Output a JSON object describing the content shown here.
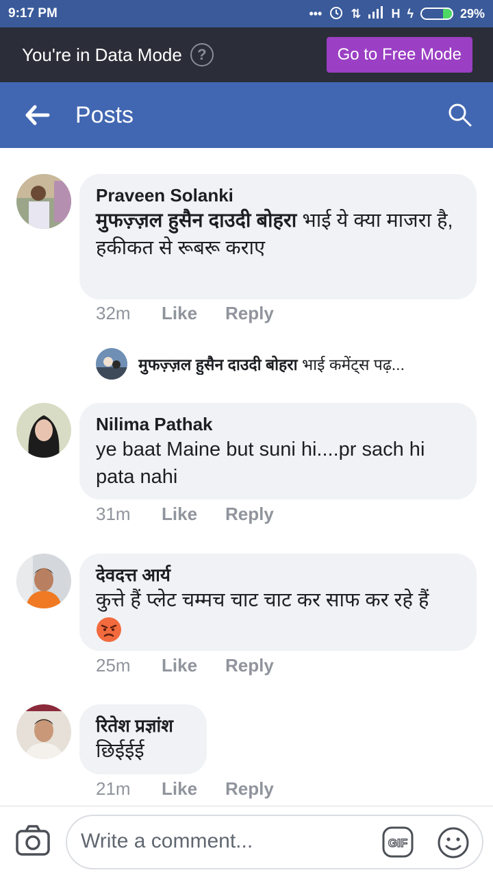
{
  "status_bar": {
    "time": "9:17 PM",
    "signal_text": "H",
    "battery_percent": "29%",
    "battery_level": 0.29
  },
  "data_banner": {
    "text": "You're in Data Mode",
    "help_glyph": "?",
    "button_label": "Go to Free Mode"
  },
  "app_bar": {
    "title": "Posts",
    "back_icon": "arrow-left-icon",
    "search_icon": "search-icon"
  },
  "comments": [
    {
      "author": "Praveen Solanki",
      "mention": "मुफज़्ज़ल हुसैन दाउदी बोहरा",
      "text_after_mention": " भाई ये क्या माजरा है,",
      "text_line2": "हकीकत से रूबरू कराए",
      "time": "32m",
      "like": "Like",
      "reply": "Reply"
    },
    {
      "author": "Nilima Pathak",
      "text": "ye baat Maine but suni hi....pr sach hi pata nahi",
      "time": "31m",
      "like": "Like",
      "reply": "Reply"
    },
    {
      "author": "देवदत्त आर्य",
      "text": "कुत्ते हैं प्लेट चम्मच चाट चाट कर साफ कर रहे हैं",
      "emoji": "angry-face-emoji",
      "time": "25m",
      "like": "Like",
      "reply": "Reply"
    },
    {
      "author": "रितेश प्रज्ञांश",
      "text": "छिईईई",
      "time": "21m",
      "like": "Like",
      "reply": "Reply"
    }
  ],
  "reply_preview": {
    "mention": "मुफज़्ज़ल हुसैन दाउदी बोहरा",
    "text": " भाई कमेंट्स पढ़..."
  },
  "composer": {
    "placeholder": "Write a comment...",
    "gif_label": "GIF"
  },
  "colors": {
    "status_bar": "#3a5a9a",
    "banner": "#2b2e38",
    "free_mode_button": "#9b3fc4",
    "app_bar": "#4267b2",
    "bubble": "#f0f2f5",
    "meta_text": "#90949c"
  }
}
